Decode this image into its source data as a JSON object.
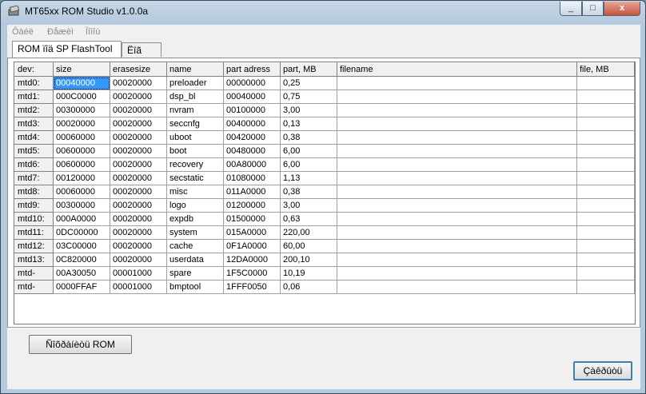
{
  "window": {
    "title": "MT65xx ROM Studio v1.0.0a",
    "close_glyph": "x",
    "min_glyph": "_",
    "max_glyph": "□"
  },
  "menu": [
    "Ôàéë",
    "Ðåæèì",
    "Ïîìîù"
  ],
  "tabs": [
    "ROM ïîä SP FlashTool",
    "Ëîã"
  ],
  "grid": {
    "columns": [
      "dev:",
      "size",
      "erasesize",
      "name",
      "part adress",
      "part, MB",
      "filename",
      "file, MB"
    ],
    "rows": [
      [
        "mtd0:",
        "00040000",
        "00020000",
        "preloader",
        "00000000",
        "0,25",
        "",
        ""
      ],
      [
        "mtd1:",
        "000C0000",
        "00020000",
        "dsp_bl",
        "00040000",
        "0,75",
        "",
        ""
      ],
      [
        "mtd2:",
        "00300000",
        "00020000",
        "nvram",
        "00100000",
        "3,00",
        "",
        ""
      ],
      [
        "mtd3:",
        "00020000",
        "00020000",
        "seccnfg",
        "00400000",
        "0,13",
        "",
        ""
      ],
      [
        "mtd4:",
        "00060000",
        "00020000",
        "uboot",
        "00420000",
        "0,38",
        "",
        ""
      ],
      [
        "mtd5:",
        "00600000",
        "00020000",
        "boot",
        "00480000",
        "6,00",
        "",
        ""
      ],
      [
        "mtd6:",
        "00600000",
        "00020000",
        "recovery",
        "00A80000",
        "6,00",
        "",
        ""
      ],
      [
        "mtd7:",
        "00120000",
        "00020000",
        "secstatic",
        "01080000",
        "1,13",
        "",
        ""
      ],
      [
        "mtd8:",
        "00060000",
        "00020000",
        "misc",
        "011A0000",
        "0,38",
        "",
        ""
      ],
      [
        "mtd9:",
        "00300000",
        "00020000",
        "logo",
        "01200000",
        "3,00",
        "",
        ""
      ],
      [
        "mtd10:",
        "000A0000",
        "00020000",
        "expdb",
        "01500000",
        "0,63",
        "",
        ""
      ],
      [
        "mtd11:",
        "0DC00000",
        "00020000",
        "system",
        "015A0000",
        "220,00",
        "",
        ""
      ],
      [
        "mtd12:",
        "03C00000",
        "00020000",
        "cache",
        "0F1A0000",
        "60,00",
        "",
        ""
      ],
      [
        "mtd13:",
        "0C820000",
        "00020000",
        "userdata",
        "12DA0000",
        "200,10",
        "",
        ""
      ],
      [
        "mtd-",
        "00A30050",
        "00001000",
        "spare",
        "1F5C0000",
        "10,19",
        "",
        ""
      ],
      [
        "mtd-",
        "0000FFAF",
        "00001000",
        "bmptool",
        "1FFF0050",
        "0,06",
        "",
        ""
      ]
    ]
  },
  "buttons": {
    "save": "Ñîõðàíèòü ROM",
    "close": "Çàêðûòü"
  }
}
